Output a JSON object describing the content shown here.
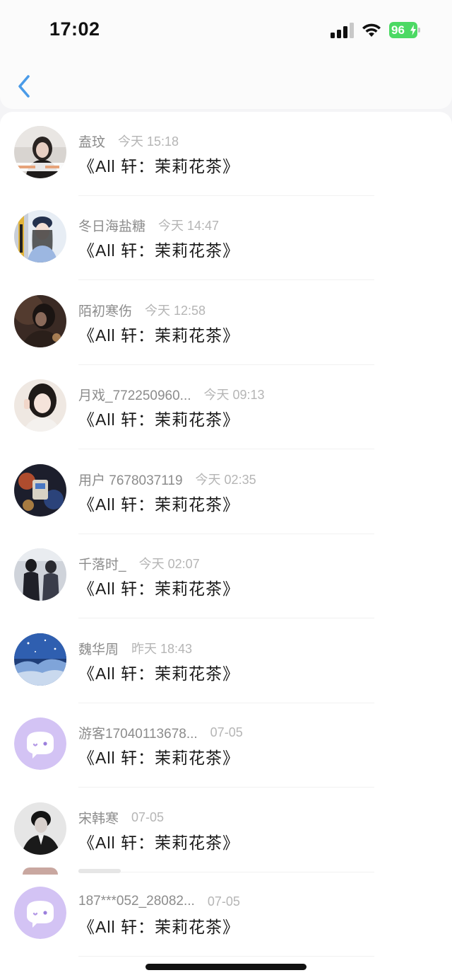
{
  "status_bar": {
    "time": "17:02",
    "battery": "96",
    "icons": [
      "signal-icon",
      "wifi-icon",
      "battery-charging-icon"
    ],
    "battery_color": "#4cd964"
  },
  "nav": {
    "back_icon": "chevron-left-icon",
    "accent": "#4a9be8"
  },
  "messages": [
    {
      "user": "盍玟",
      "time": "今天 15:18",
      "text": "《All 轩：茉莉花茶》",
      "avatar": "photo"
    },
    {
      "user": "冬日海盐糖",
      "time": "今天 14:47",
      "text": "《All 轩：茉莉花茶》",
      "avatar": "photo"
    },
    {
      "user": "陌初寒伤",
      "time": "今天 12:58",
      "text": "《All 轩：茉莉花茶》",
      "avatar": "photo"
    },
    {
      "user": "月戏_772250960...",
      "time": "今天 09:13",
      "text": "《All 轩：茉莉花茶》",
      "avatar": "photo"
    },
    {
      "user": "用户 7678037119",
      "time": "今天 02:35",
      "text": "《All 轩：茉莉花茶》",
      "avatar": "photo"
    },
    {
      "user": "千落时_",
      "time": "今天 02:07",
      "text": "《All 轩：茉莉花茶》",
      "avatar": "photo"
    },
    {
      "user": "魏华周",
      "time": "昨天 18:43",
      "text": "《All 轩：茉莉花茶》",
      "avatar": "photo"
    },
    {
      "user": "游客17040113678...",
      "time": "07-05",
      "text": "《All 轩：茉莉花茶》",
      "avatar": "default-chat-avatar-icon"
    },
    {
      "user": "宋韩寒",
      "time": "07-05",
      "text": "《All 轩：茉莉花茶》",
      "avatar": "photo"
    },
    {
      "user": "187***052_28082...",
      "time": "07-05",
      "text": "《All 轩：茉莉花茶》",
      "avatar": "default-chat-avatar-icon"
    }
  ]
}
